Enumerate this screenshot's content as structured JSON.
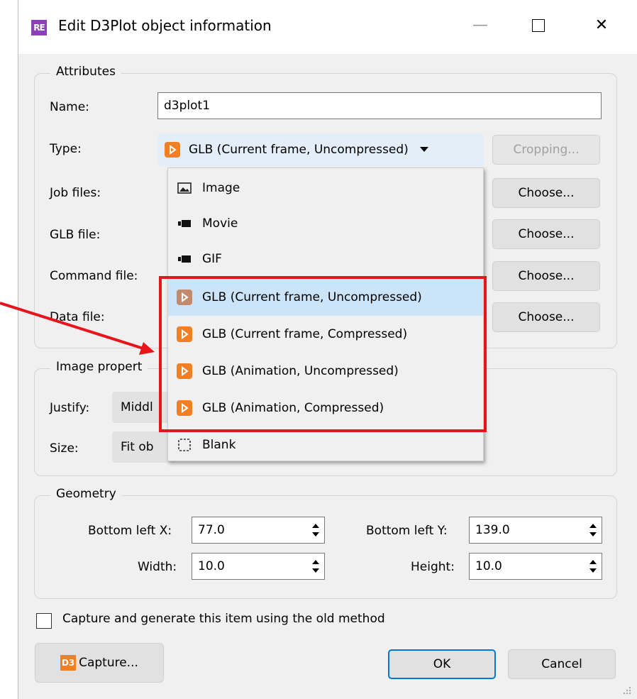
{
  "window": {
    "app_icon_text": "RE",
    "title": "Edit D3Plot object information",
    "minimize": "—",
    "close": "✕"
  },
  "attributes": {
    "group_title": "Attributes",
    "name_label": "Name:",
    "name_value": "d3plot1",
    "type_label": "Type:",
    "type_selected": "GLB (Current frame, Uncompressed)",
    "cropping_label": "Cropping...",
    "job_files_label": "Job files:",
    "glb_file_label": "GLB file:",
    "command_file_label": "Command file:",
    "data_file_label": "Data file:",
    "choose_label": "Choose..."
  },
  "type_dropdown": {
    "options": [
      {
        "label": "Image",
        "icon": "image-icon"
      },
      {
        "label": "Movie",
        "icon": "movie-camera-icon"
      },
      {
        "label": "GIF",
        "icon": "movie-camera-icon"
      },
      {
        "label": "GLB (Current frame, Uncompressed)",
        "icon": "glb-icon",
        "selected": true
      },
      {
        "label": "GLB (Current frame, Compressed)",
        "icon": "glb-icon"
      },
      {
        "label": "GLB (Animation, Uncompressed)",
        "icon": "glb-icon"
      },
      {
        "label": "GLB (Animation, Compressed)",
        "icon": "glb-icon"
      },
      {
        "label": "Blank",
        "icon": "dashed-square-icon"
      }
    ]
  },
  "image_properties": {
    "group_title": "Image propert",
    "justify_label": "Justify:",
    "justify_value": "Middl",
    "size_label": "Size:",
    "size_value": "Fit ob"
  },
  "geometry": {
    "group_title": "Geometry",
    "bottom_left_x_label": "Bottom left X:",
    "bottom_left_x_value": "77.0",
    "bottom_left_y_label": "Bottom left Y:",
    "bottom_left_y_value": "139.0",
    "width_label": "Width:",
    "width_value": "10.0",
    "height_label": "Height:",
    "height_value": "10.0"
  },
  "old_method_checkbox_label": "Capture and generate this item using the old method",
  "footer": {
    "capture_icon_text": "D3",
    "capture_label": "Capture...",
    "ok_label": "OK",
    "cancel_label": "Cancel"
  },
  "colors": {
    "highlight_box": "#e8141c",
    "glb_orange": "#f08023",
    "selection": "#cce4f7"
  }
}
